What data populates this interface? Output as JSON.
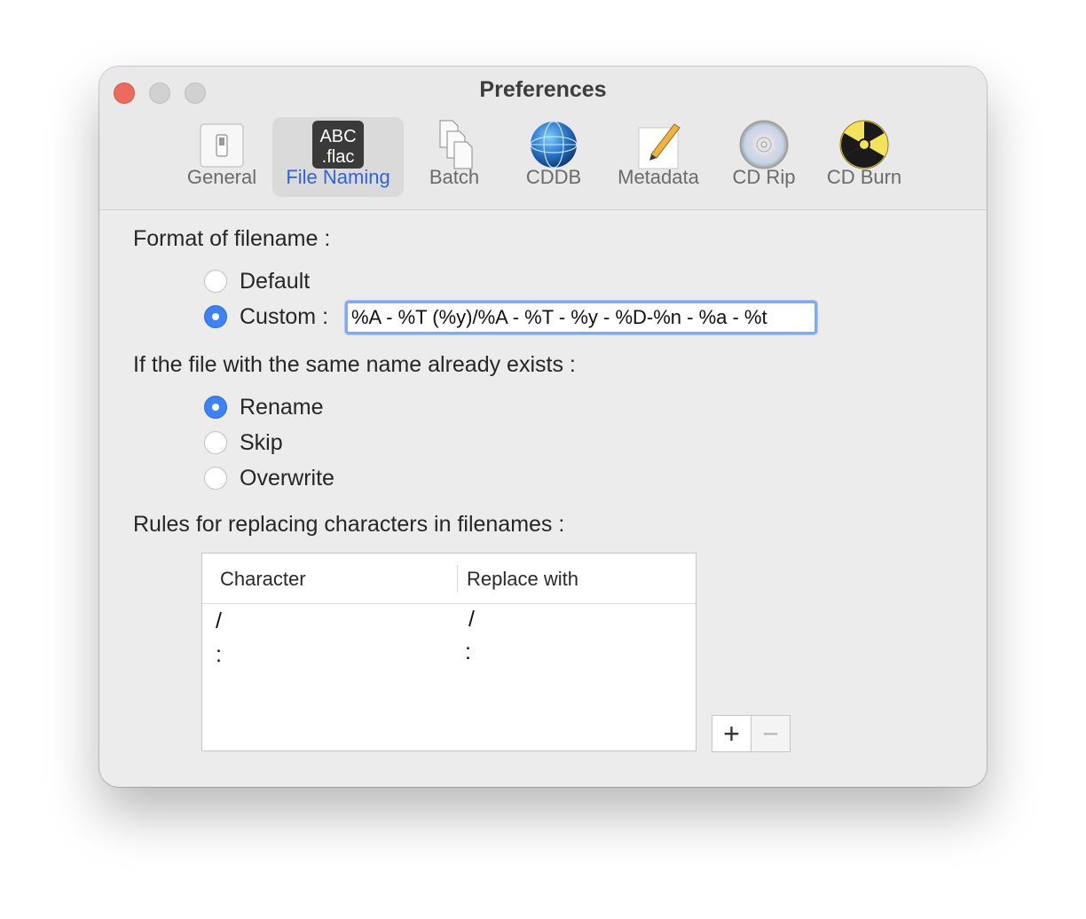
{
  "window": {
    "title": "Preferences"
  },
  "toolbar": {
    "items": [
      {
        "label": "General",
        "icon": "switch-icon"
      },
      {
        "label": "File Naming",
        "icon": "abc-flac-icon",
        "icon_text_top": "ABC",
        "icon_text_bottom": ".flac",
        "selected": true
      },
      {
        "label": "Batch",
        "icon": "stacked-documents-icon"
      },
      {
        "label": "CDDB",
        "icon": "globe-icon"
      },
      {
        "label": "Metadata",
        "icon": "pencil-note-icon"
      },
      {
        "label": "CD Rip",
        "icon": "cd-disc-icon"
      },
      {
        "label": "CD Burn",
        "icon": "radiation-icon"
      }
    ]
  },
  "format": {
    "label": "Format of filename :",
    "default_label": "Default",
    "custom_label": "Custom :",
    "selected": "custom",
    "custom_value": "%A - %T (%y)/%A - %T - %y - %D-%n - %a - %t"
  },
  "exists": {
    "label": "If the file with the same name already exists :",
    "options": [
      "Rename",
      "Skip",
      "Overwrite"
    ],
    "selected": "Rename"
  },
  "rules": {
    "label": "Rules for replacing characters in filenames :",
    "columns": [
      "Character",
      "Replace with"
    ],
    "rows": [
      {
        "character": "/",
        "replace": "/"
      },
      {
        "character": ":",
        "replace": ":"
      }
    ],
    "add_label": "+",
    "remove_label": "−"
  },
  "colors": {
    "accent": "#3d82f6",
    "selected_label": "#2f64d6",
    "close": "#ed6a5e"
  }
}
